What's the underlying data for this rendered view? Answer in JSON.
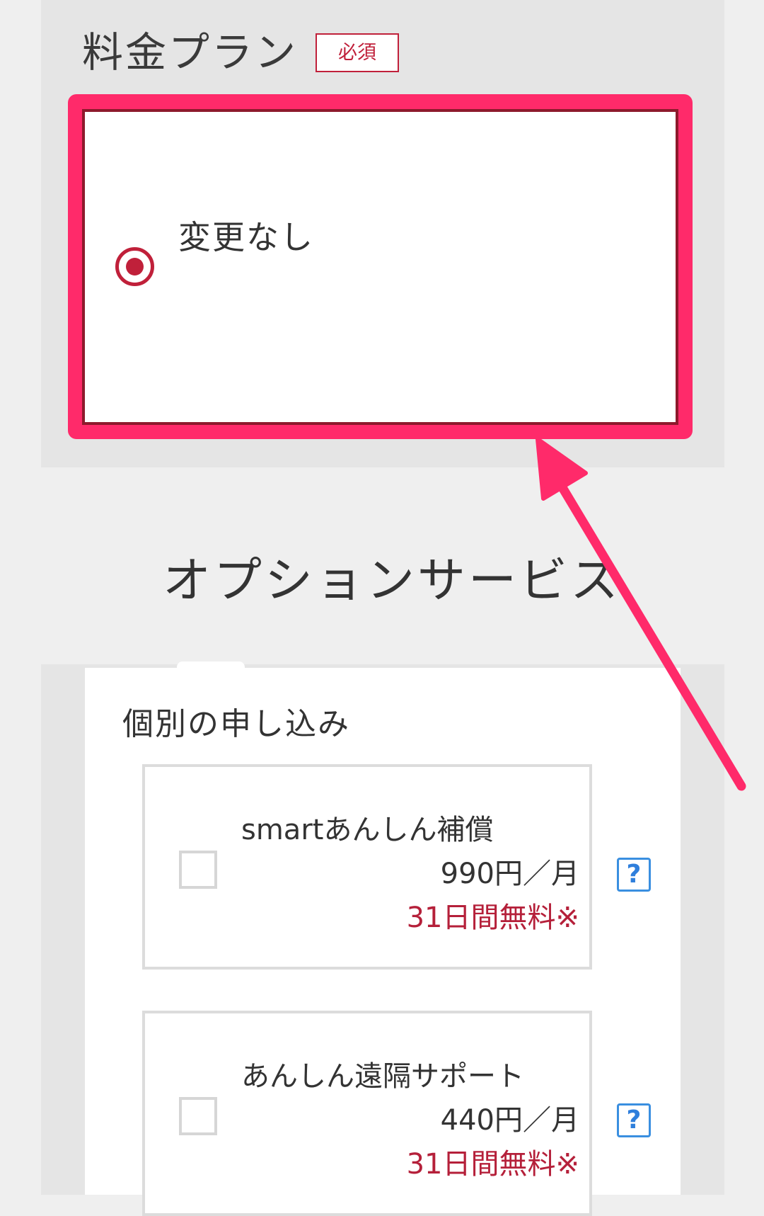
{
  "plan": {
    "title": "料金プラン",
    "required_badge": "必須",
    "selected_option": "変更なし"
  },
  "options": {
    "heading": "オプションサービス",
    "individual_title": "個別の申し込み",
    "items": [
      {
        "name": "smartあんしん補償",
        "price": "990円／月",
        "promo": "31日間無料※",
        "help": "?",
        "checked": false
      },
      {
        "name": "あんしん遠隔サポート",
        "price": "440円／月",
        "promo": "31日間無料※",
        "help": "?",
        "checked": false
      }
    ]
  },
  "colors": {
    "accent": "#c0203a",
    "highlight": "#ff2a6a",
    "help_blue": "#3a8fe0"
  }
}
